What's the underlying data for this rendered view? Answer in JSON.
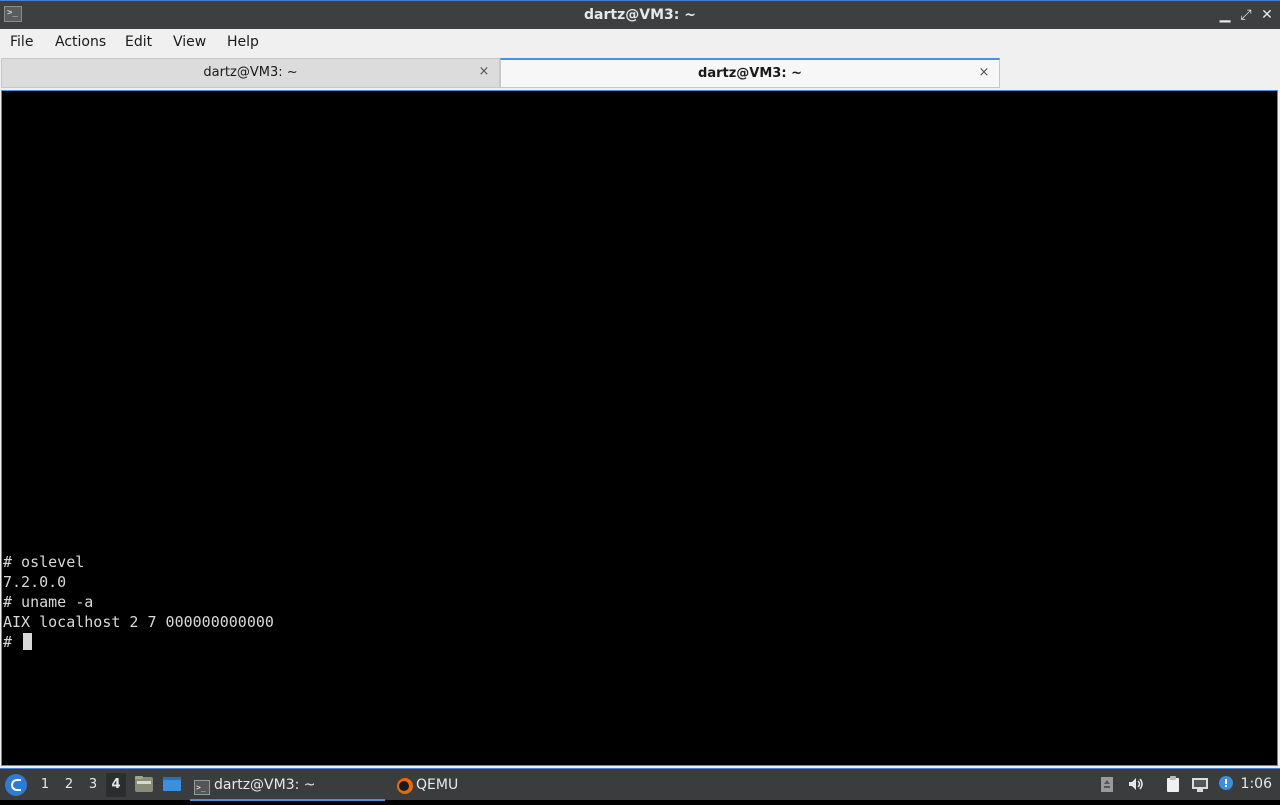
{
  "window": {
    "title": "dartz@VM3: ~",
    "minimize_glyph": "▁",
    "maximize_glyph": "⤢",
    "close_glyph": "✕"
  },
  "menu": {
    "items": [
      {
        "label": "File"
      },
      {
        "label": "Actions"
      },
      {
        "label": "Edit"
      },
      {
        "label": "View"
      },
      {
        "label": "Help"
      }
    ]
  },
  "tabs": [
    {
      "label": "dartz@VM3: ~",
      "active": false,
      "close_glyph": "×"
    },
    {
      "label": "dartz@VM3: ~",
      "active": true,
      "close_glyph": "×"
    }
  ],
  "terminal": {
    "lines": [
      "# oslevel",
      "7.2.0.0",
      "# uname -a",
      "AIX localhost 2 7 000000000000",
      "# "
    ]
  },
  "taskbar": {
    "desktops": [
      "1",
      "2",
      "3",
      "4"
    ],
    "current_desktop": "4",
    "tasks": [
      {
        "label": "dartz@VM3: ~",
        "icon": "terminal-icon",
        "active": true
      },
      {
        "label": "QEMU",
        "icon": "qemu-icon",
        "active": false
      }
    ],
    "clock": "1:06"
  },
  "colors": {
    "accent": "#4a90d9",
    "titlebar": "#3d3f41",
    "taskbar": "#3a3c3e",
    "terminal_bg": "#000000",
    "terminal_fg": "#d8d8d8"
  }
}
